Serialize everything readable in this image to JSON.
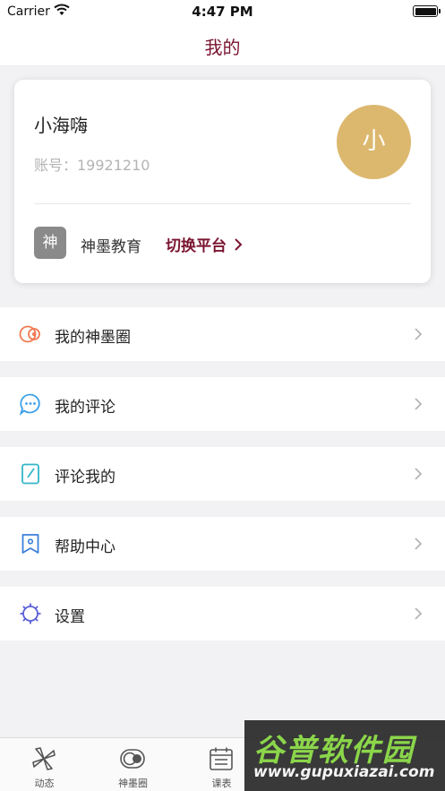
{
  "status_bar": {
    "carrier": "Carrier",
    "time": "4:47 PM"
  },
  "nav": {
    "title": "我的"
  },
  "profile": {
    "name": "小海嗨",
    "account": "账号：19921210",
    "avatar_text": "小",
    "avatar_color": "#dcb86f",
    "org_badge": "神",
    "org_name": "神墨教育",
    "switch_label": "切换平台"
  },
  "menu": [
    {
      "label": "我的神墨圈",
      "icon": "circle-chat-icon",
      "color": "#f07a52"
    },
    {
      "label": "我的评论",
      "icon": "speech-bubble-icon",
      "color": "#3aa0e8"
    },
    {
      "label": "评论我的",
      "icon": "edit-note-icon",
      "color": "#33b6c8"
    },
    {
      "label": "帮助中心",
      "icon": "bookmark-pin-icon",
      "color": "#3b7fd9"
    },
    {
      "label": "设置",
      "icon": "gear-icon",
      "color": "#5a5fd6"
    }
  ],
  "tabbar": [
    {
      "label": "动态",
      "icon": "pinwheel-icon"
    },
    {
      "label": "神墨圈",
      "icon": "toggle-circle-icon"
    },
    {
      "label": "课表",
      "icon": "calendar-icon"
    }
  ],
  "watermark": {
    "title": "谷普软件园",
    "url": "www.gupuxiazai.com"
  },
  "colors": {
    "accent": "#7a1430",
    "background": "#f2f2f4"
  }
}
